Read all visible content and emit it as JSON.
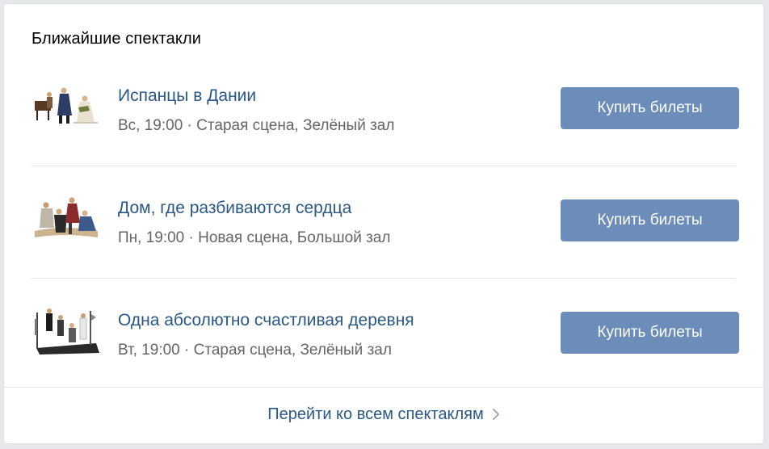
{
  "widget": {
    "title": "Ближайшие спектакли"
  },
  "shows": [
    {
      "title": "Испанцы в Дании",
      "meta": "Вс, 19:00 · Старая сцена, Зелёный зал",
      "button_label": "Купить билеты",
      "thumb_icon": "performance-photo"
    },
    {
      "title": "Дом, где разбиваются сердца",
      "meta": "Пн, 19:00 · Новая сцена, Большой зал",
      "button_label": "Купить билеты",
      "thumb_icon": "performance-photo"
    },
    {
      "title": "Одна абсолютно счастливая деревня",
      "meta": "Вт, 19:00 · Старая сцена, Зелёный зал",
      "button_label": "Купить билеты",
      "thumb_icon": "performance-photo"
    }
  ],
  "footer": {
    "link_label": "Перейти ко всем спектаклям",
    "icon": "chevron-right-icon"
  },
  "colors": {
    "link": "#2a5885",
    "button": "#6c8dba",
    "meta_text": "#656565",
    "divider": "#e1e3e6"
  }
}
